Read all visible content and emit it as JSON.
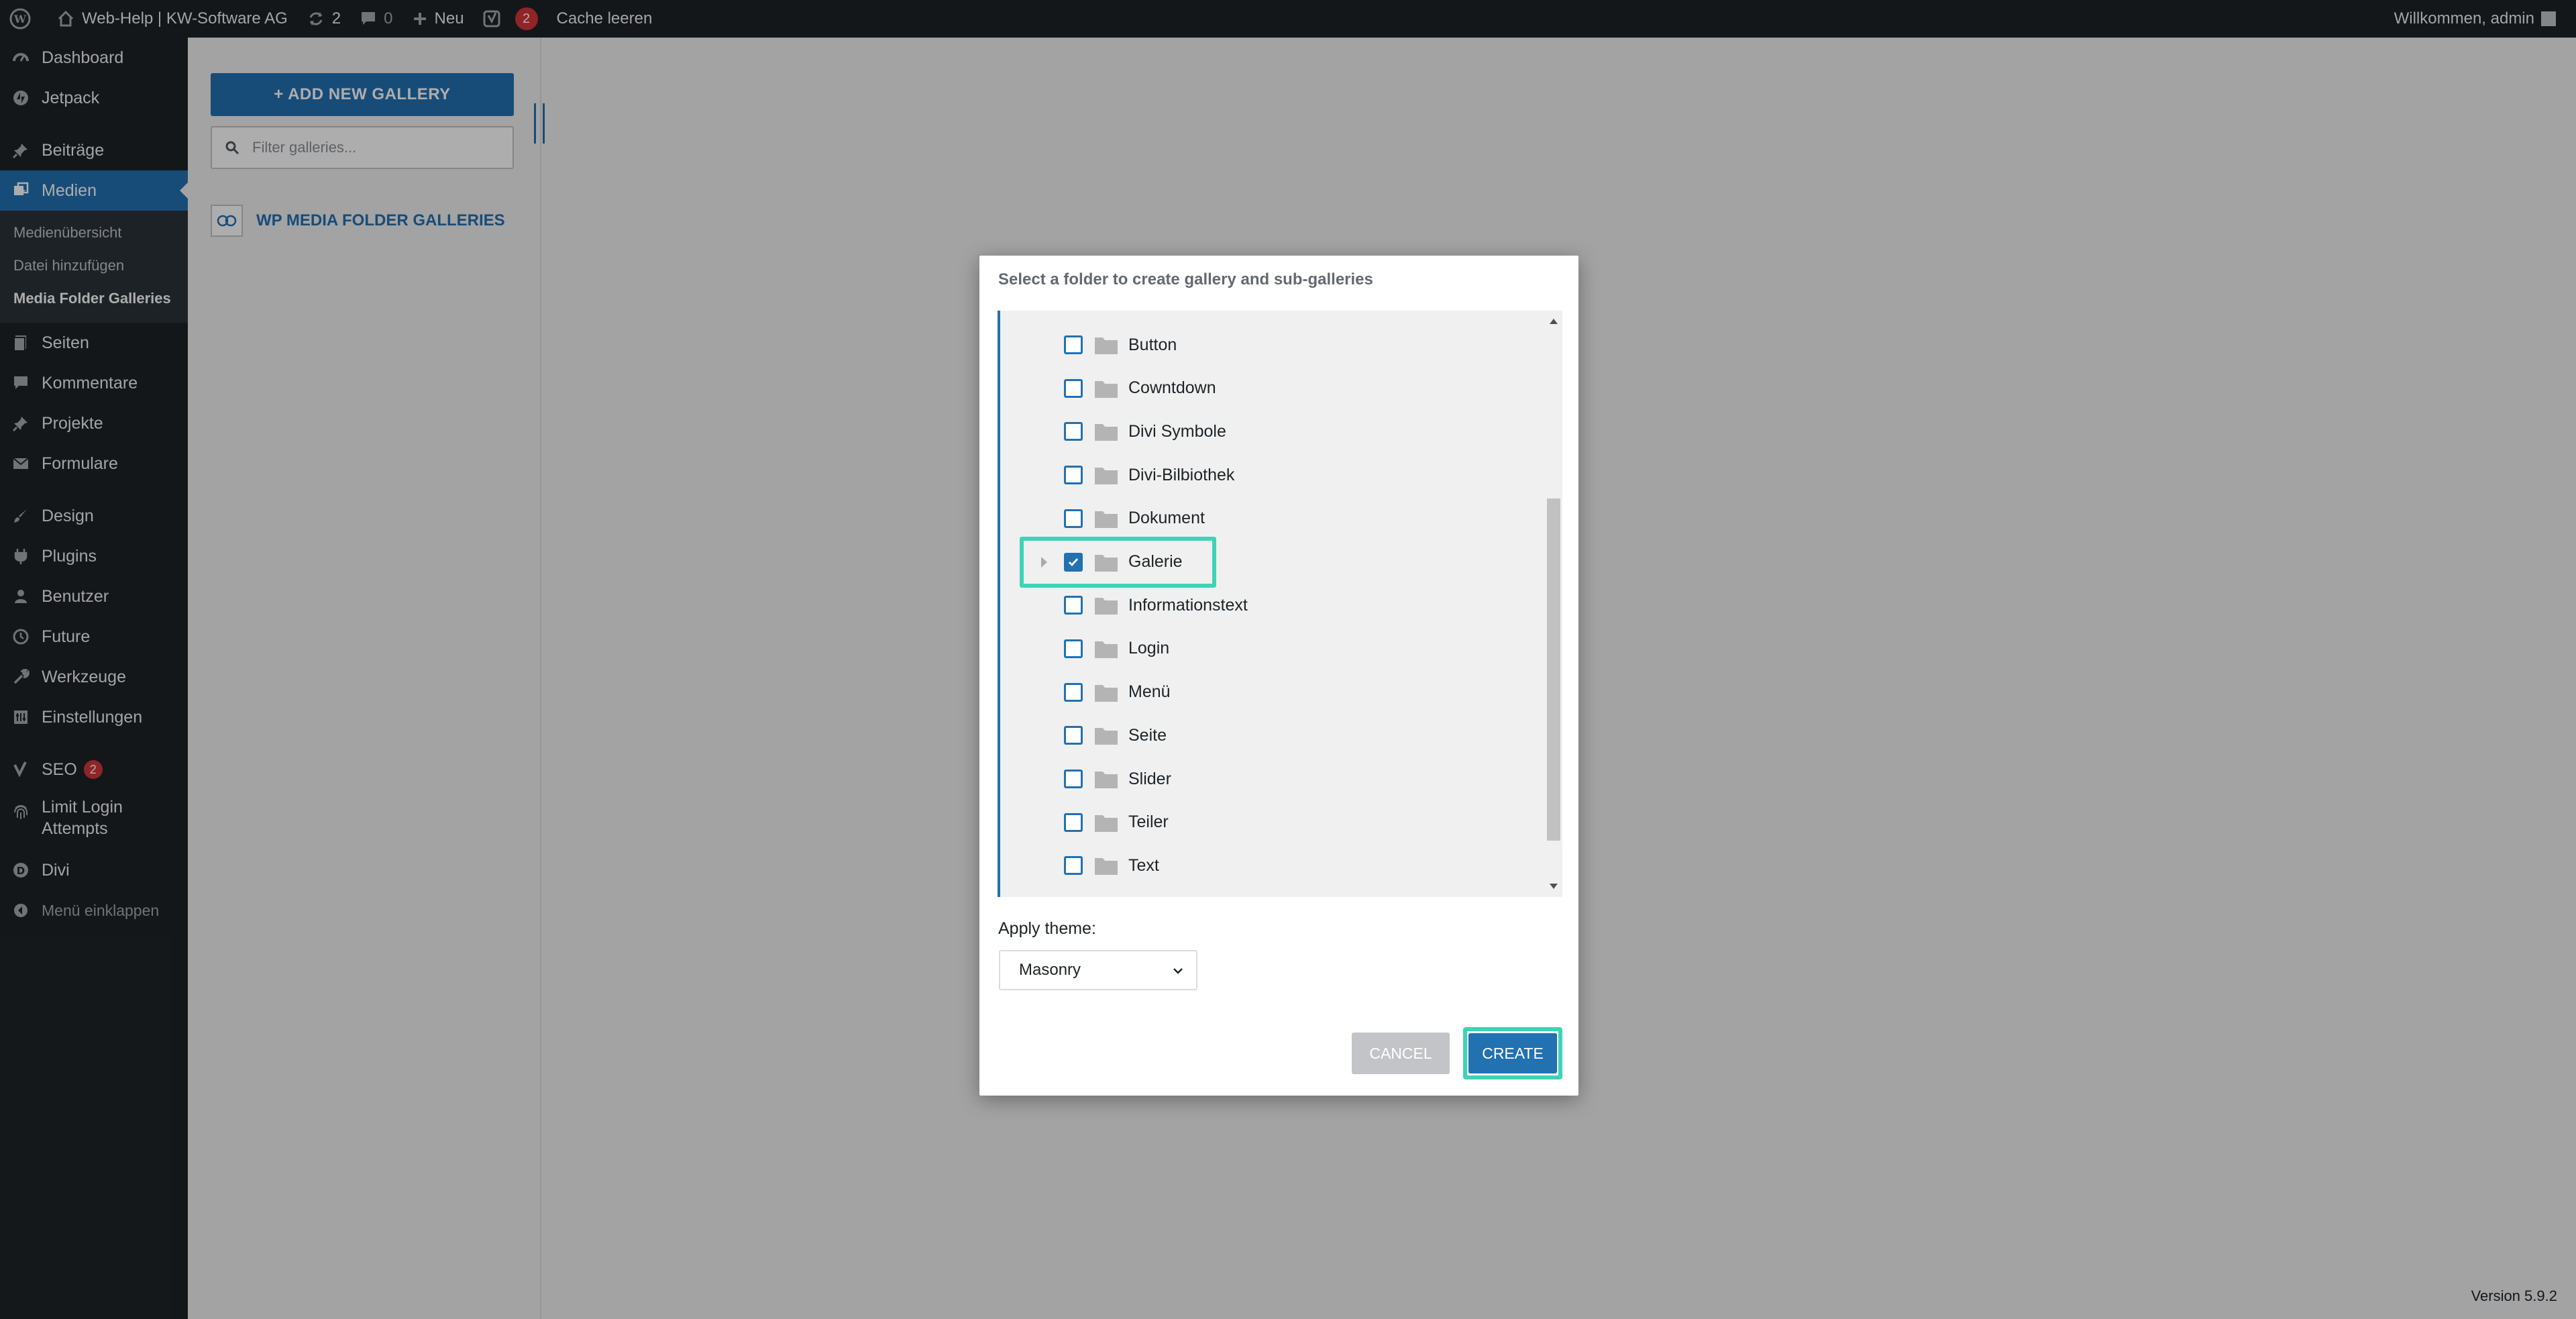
{
  "adminbar": {
    "site_name": "Web-Help | KW-Software AG",
    "updates_count": "2",
    "comments_count": "0",
    "new_label": "Neu",
    "yoast_badge": "2",
    "cache_label": "Cache leeren",
    "welcome": "Willkommen, admin"
  },
  "sidebar": {
    "dashboard": "Dashboard",
    "jetpack": "Jetpack",
    "beitraege": "Beiträge",
    "medien": "Medien",
    "sub": [
      "Medienübersicht",
      "Datei hinzufügen",
      "Media Folder Galleries"
    ],
    "seiten": "Seiten",
    "kommentare": "Kommentare",
    "projekte": "Projekte",
    "formulare": "Formulare",
    "design": "Design",
    "plugins": "Plugins",
    "benutzer": "Benutzer",
    "future": "Future",
    "werkzeuge": "Werkzeuge",
    "einstellungen": "Einstellungen",
    "seo": "SEO",
    "seo_badge": "2",
    "limit_login_1": "Limit Login",
    "limit_login_2": "Attempts",
    "divi": "Divi",
    "collapse": "Menü einklappen"
  },
  "gallery_panel": {
    "add_button": "+ ADD NEW GALLERY",
    "filter_placeholder": "Filter galleries...",
    "root_label": "WP MEDIA FOLDER GALLERIES"
  },
  "modal": {
    "title": "Select a folder to create gallery and sub-galleries",
    "folders": [
      {
        "label": "Button",
        "checked": false
      },
      {
        "label": "Cowntdown",
        "checked": false
      },
      {
        "label": "Divi Symbole",
        "checked": false
      },
      {
        "label": "Divi-Bilbiothek",
        "checked": false
      },
      {
        "label": "Dokument",
        "checked": false
      },
      {
        "label": "Galerie",
        "checked": true
      },
      {
        "label": "Informationstext",
        "checked": false
      },
      {
        "label": "Login",
        "checked": false
      },
      {
        "label": "Menü",
        "checked": false
      },
      {
        "label": "Seite",
        "checked": false
      },
      {
        "label": "Slider",
        "checked": false
      },
      {
        "label": "Teiler",
        "checked": false
      },
      {
        "label": "Text",
        "checked": false
      }
    ],
    "theme_label": "Apply theme:",
    "theme_value": "Masonry",
    "cancel": "CANCEL",
    "create": "CREATE"
  },
  "footer": {
    "version": "Version 5.9.2"
  },
  "colors": {
    "accent": "#2271b1",
    "highlight": "#3fd3b6",
    "adminbar": "#1d2327"
  }
}
